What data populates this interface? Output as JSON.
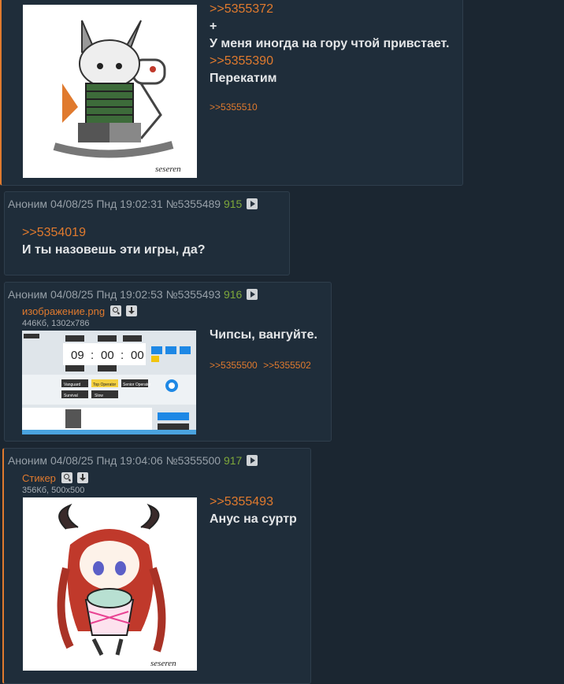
{
  "posts": [
    {
      "replies": [
        ">>5355372",
        ">>5355390"
      ],
      "lines": [
        "+",
        "У меня иногда на гору чтой привстает.",
        "Перекатим"
      ],
      "backlinks": [
        ">>5355510"
      ],
      "thumb_signature": "seseren"
    },
    {
      "author": "Аноним",
      "date": "04/08/25 Пнд 19:02:31",
      "id": "№5355489",
      "num": "915",
      "reply": ">>5354019",
      "text": "И ты назовешь эти игры, да?"
    },
    {
      "author": "Аноним",
      "date": "04/08/25 Пнд 19:02:53",
      "id": "№5355493",
      "num": "916",
      "file_name": "изображение.png",
      "file_meta": "446Кб, 1302x786",
      "text": "Чипсы, вангуйте.",
      "backlinks": [
        ">>5355500",
        ">>5355502"
      ],
      "thumb": {
        "time_h": "09",
        "time_m": "00",
        "time_s": "00",
        "btn_vanguard": "Vanguard",
        "btn_top": "Top Operator",
        "btn_senior": "Senior Operator",
        "btn_survival": "Survival",
        "btn_slow": "Slow"
      }
    },
    {
      "author": "Аноним",
      "date": "04/08/25 Пнд 19:04:06",
      "id": "№5355500",
      "num": "917",
      "file_name": "Стикер",
      "file_meta": "356Кб, 500x500",
      "reply": ">>5355493",
      "text": "Анус на суртр",
      "thumb_signature": "seseren"
    }
  ],
  "colors": {
    "background": "#1b2631",
    "post_bg": "#1f2d3a",
    "link": "#e07a2e",
    "post_number": "#7ea83a",
    "header_text": "#97a0a8"
  }
}
